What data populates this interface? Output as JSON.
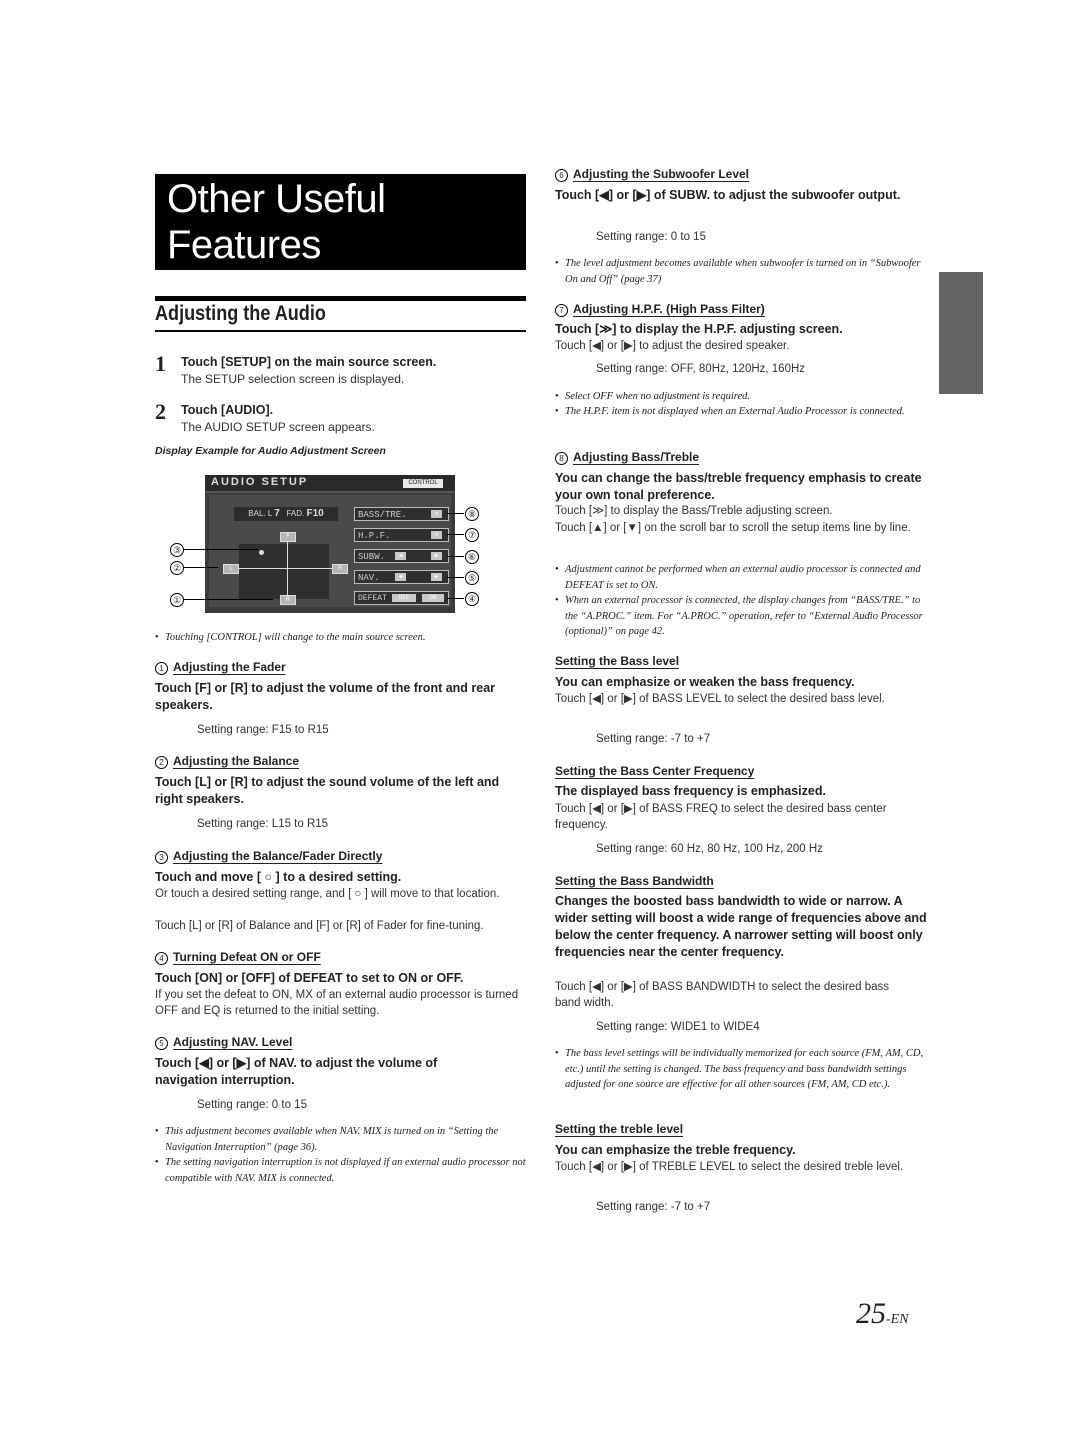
{
  "chapter": {
    "title_line1": "Other Useful",
    "title_line2": "Features"
  },
  "section": {
    "title": "Adjusting the Audio"
  },
  "steps": [
    {
      "num": "1",
      "title": "Touch [SETUP] on the main source screen.",
      "desc": "The SETUP selection screen is displayed."
    },
    {
      "num": "2",
      "title": "Touch [AUDIO].",
      "desc": "The AUDIO SETUP screen appears."
    }
  ],
  "figure": {
    "caption": "Display Example for Audio Adjustment Screen",
    "screen_title": "AUDIO SETUP",
    "control_label": "CONTROL",
    "balfad_prefix_bal": "BAL. L",
    "balfad_bal_value": "7",
    "balfad_prefix_fad": "FAD.",
    "balfad_fad_value": "F10",
    "pad_buttons": {
      "front": "F",
      "rear": "R",
      "left": "L",
      "right": "R"
    },
    "menu": [
      {
        "label": "BASS/TRE.",
        "arrow": "»"
      },
      {
        "label": "H.P.F.",
        "arrow": "»"
      },
      {
        "label": "SUBW.",
        "left": "◀",
        "right": "▶"
      },
      {
        "label": "NAV.",
        "left": "◀",
        "right": "▶"
      },
      {
        "label": "DEFEAT",
        "off": "OFF",
        "on": "ON"
      }
    ],
    "callouts": [
      "①",
      "②",
      "③",
      "④",
      "⑤",
      "⑥",
      "⑦",
      "⑧"
    ]
  },
  "left_notes": {
    "control_note": "Touching [CONTROL] will change to the main source screen."
  },
  "fader": {
    "num": "1",
    "heading": "Adjusting the Fader",
    "lead": "Touch [F] or [R] to adjust the volume of the front and rear speakers.",
    "range": "Setting range: F15 to R15"
  },
  "balance": {
    "num": "2",
    "heading": "Adjusting the Balance",
    "lead": "Touch [L] or [R] to adjust the sound volume of the left and right speakers.",
    "range": "Setting range: L15 to R15"
  },
  "direct": {
    "num": "3",
    "heading": "Adjusting the Balance/Fader Directly",
    "lead": "Touch and move [ ○ ] to a desired setting.",
    "body1": "Or touch a desired setting range, and [ ○ ] will move to that location.",
    "body2": "Touch [L] or [R] of Balance and [F] or [R] of Fader for fine-tuning."
  },
  "defeat": {
    "num": "4",
    "heading": "Turning Defeat ON or OFF",
    "lead": "Touch [ON] or [OFF] of DEFEAT to set to ON or OFF.",
    "body": "If you set the defeat to ON, MX of an external audio processor is turned OFF and EQ is returned to the initial setting."
  },
  "nav": {
    "num": "5",
    "heading": "Adjusting NAV. Level",
    "lead": "Touch [◀] or [▶] of NAV. to adjust the volume of navigation interruption.",
    "range": "Setting range: 0 to 15",
    "notes": [
      "This adjustment becomes available when NAV. MIX is turned on in “Setting the Navigation Interruption” (page 36).",
      "The setting navigation interruption is not displayed if an external audio processor not compatible with NAV. MIX is connected."
    ]
  },
  "subw": {
    "num": "6",
    "heading": "Adjusting the Subwoofer Level",
    "lead": "Touch [◀] or [▶] of SUBW. to adjust the subwoofer output.",
    "range": "Setting range: 0 to 15",
    "notes": [
      "The level adjustment becomes available when subwoofer is turned on in “Subwoofer On and Off” (page 37)"
    ]
  },
  "hpf": {
    "num": "7",
    "heading": "Adjusting H.P.F. (High Pass Filter)",
    "lead": "Touch [≫] to display the H.P.F. adjusting screen.",
    "body": "Touch [◀] or [▶] to adjust the desired speaker.",
    "range": "Setting range: OFF, 80Hz, 120Hz, 160Hz",
    "notes": [
      "Select OFF when no adjustment is required.",
      "The H.P.F. item is not displayed when an External Audio Processor is connected."
    ]
  },
  "basstre": {
    "num": "8",
    "heading": "Adjusting Bass/Treble",
    "lead": "You can change the bass/treble frequency emphasis to create your own tonal preference.",
    "body1": "Touch [≫] to display the Bass/Treble adjusting screen.",
    "body2": "Touch [▲] or [▼] on the scroll bar to scroll the setup items line by line.",
    "notes": [
      "Adjustment cannot be performed when an external audio processor is connected and DEFEAT is set to ON.",
      "When an external processor is connected, the display changes from “BASS/TRE.” to the “A.PROC.” item. For “A.PROC.” operation, refer to “External Audio Processor (optional)” on page 42."
    ]
  },
  "bass_level": {
    "heading": "Setting the Bass level",
    "lead": "You can emphasize or weaken the bass frequency.",
    "body": "Touch [◀] or [▶] of BASS LEVEL to select the desired bass level.",
    "range": "Setting range: -7 to +7"
  },
  "bass_freq": {
    "heading": "Setting the Bass Center Frequency",
    "lead": "The displayed bass frequency is emphasized.",
    "body": "Touch [◀] or [▶] of BASS FREQ to select the desired bass center frequency.",
    "range": "Setting range: 60 Hz, 80 Hz, 100 Hz, 200 Hz"
  },
  "bass_bw": {
    "heading": "Setting the Bass Bandwidth",
    "lead": "Changes the boosted bass bandwidth to wide or narrow. A wider setting will boost a wide range of frequencies above and below the center frequency. A narrower setting will boost only frequencies near the center frequency.",
    "body": "Touch [◀] or [▶] of BASS BANDWIDTH to select the desired bass band width.",
    "range": "Setting range: WIDE1 to WIDE4",
    "notes": [
      "The bass level settings will be individually memorized for each source (FM, AM, CD, etc.) until the setting is changed. The bass frequency and bass bandwidth settings adjusted for one source are effective for all other sources (FM, AM, CD etc.)."
    ]
  },
  "treble": {
    "heading": "Setting the treble level",
    "lead": "You can emphasize the treble frequency.",
    "body": "Touch [◀] or [▶] of TREBLE LEVEL to select the desired treble level.",
    "range": "Setting range: -7 to +7"
  },
  "page": {
    "number": "25",
    "suffix": "-EN"
  }
}
